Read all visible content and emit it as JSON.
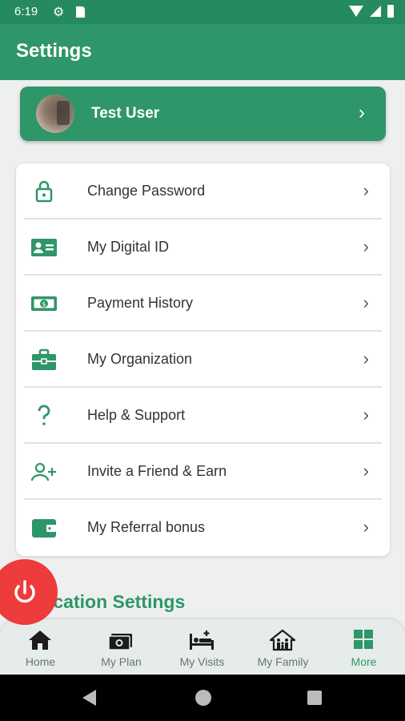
{
  "status_bar": {
    "time": "6:19",
    "icons": [
      "settings-icon",
      "sd-card-icon",
      "wifi-icon",
      "signal-icon",
      "battery-icon"
    ]
  },
  "app_bar": {
    "title": "Settings"
  },
  "profile": {
    "name": "Test User"
  },
  "menu": {
    "items": [
      {
        "label": "Change Password",
        "icon": "lock-icon"
      },
      {
        "label": "My Digital ID",
        "icon": "id-card-icon"
      },
      {
        "label": "Payment History",
        "icon": "money-icon"
      },
      {
        "label": "My Organization",
        "icon": "briefcase-icon"
      },
      {
        "label": "Help & Support",
        "icon": "question-icon"
      },
      {
        "label": "Invite a Friend & Earn",
        "icon": "add-person-icon"
      },
      {
        "label": "My Referral bonus",
        "icon": "wallet-icon"
      }
    ]
  },
  "section": {
    "title": "ication Settings"
  },
  "bottom_nav": {
    "items": [
      {
        "label": "Home",
        "icon": "home-icon"
      },
      {
        "label": "My Plan",
        "icon": "plan-icon"
      },
      {
        "label": "My Visits",
        "icon": "bed-icon"
      },
      {
        "label": "My Family",
        "icon": "family-house-icon"
      },
      {
        "label": "More",
        "icon": "grid-icon",
        "active": true
      }
    ]
  },
  "colors": {
    "primary": "#2e9668",
    "status_bar": "#258a5e",
    "power_button": "#ee3b3b"
  }
}
